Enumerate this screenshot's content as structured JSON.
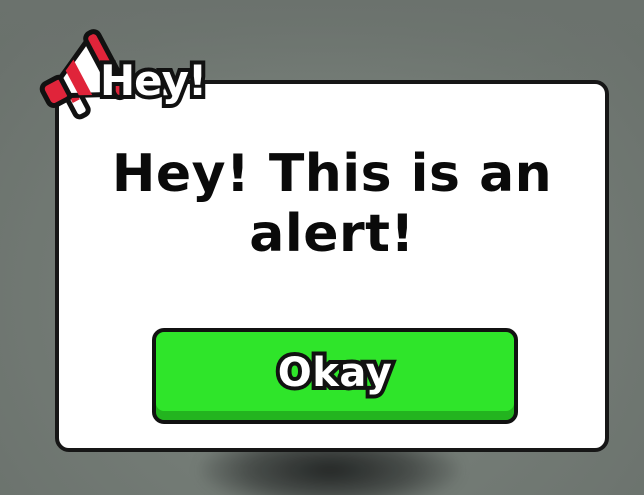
{
  "dialog": {
    "title": "Hey!",
    "message": "Hey! This is an alert!",
    "button_label": "Okay"
  },
  "icons": {
    "title_icon": "megaphone-icon"
  },
  "colors": {
    "dialog_background": "#ffffff",
    "dialog_border": "#161616",
    "button_green": "#2fe52a",
    "button_green_shadow": "#23b41f",
    "megaphone_red": "#e0243a",
    "text_dark": "#0a0a0a"
  }
}
